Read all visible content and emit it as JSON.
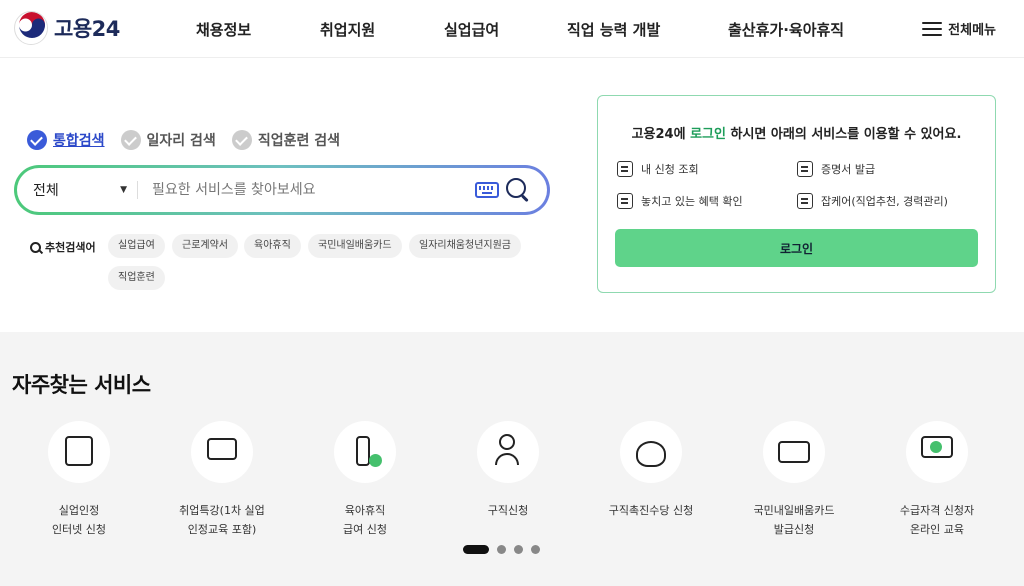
{
  "header": {
    "logo_text": "고용24",
    "nav": [
      "채용정보",
      "취업지원",
      "실업급여",
      "직업 능력 개발",
      "출산휴가·육아휴직"
    ],
    "all_menu": "전체메뉴"
  },
  "search": {
    "tabs": [
      "통합검색",
      "일자리 검색",
      "직업훈련 검색"
    ],
    "active_tab": 0,
    "select_value": "전체",
    "placeholder": "필요한 서비스를 찾아보세요",
    "rec_label": "추천검색어",
    "keywords": [
      "실업급여",
      "근로계약서",
      "육아휴직",
      "국민내일배움카드",
      "일자리채움청년지원금",
      "직업훈련"
    ]
  },
  "login": {
    "title_pre": "고용24에 ",
    "title_hl": "로그인",
    "title_post": " 하시면 아래의 서비스를 이용할 수 있어요.",
    "services": [
      "내 신청 조회",
      "증명서 발급",
      "놓치고 있는 혜택 확인",
      "잡케어(직업추천, 경력관리)"
    ],
    "button": "로그인"
  },
  "freq": {
    "title": "자주찾는 서비스",
    "items": [
      {
        "l1": "실업인정",
        "l2": "인터넷 신청"
      },
      {
        "l1": "취업특강(1차 실업",
        "l2": "인정교육 포함)"
      },
      {
        "l1": "육아휴직",
        "l2": "급여 신청"
      },
      {
        "l1": "구직신청",
        "l2": ""
      },
      {
        "l1": "구직촉진수당 신청",
        "l2": ""
      },
      {
        "l1": "국민내일배움카드",
        "l2": "발급신청"
      },
      {
        "l1": "수급자격 신청자",
        "l2": "온라인 교육"
      }
    ],
    "active_page": 1,
    "page_count": 4
  },
  "colors": {
    "accent_green": "#5fd38a",
    "accent_blue": "#3a5bd9",
    "brand_navy": "#1d2b5a"
  }
}
